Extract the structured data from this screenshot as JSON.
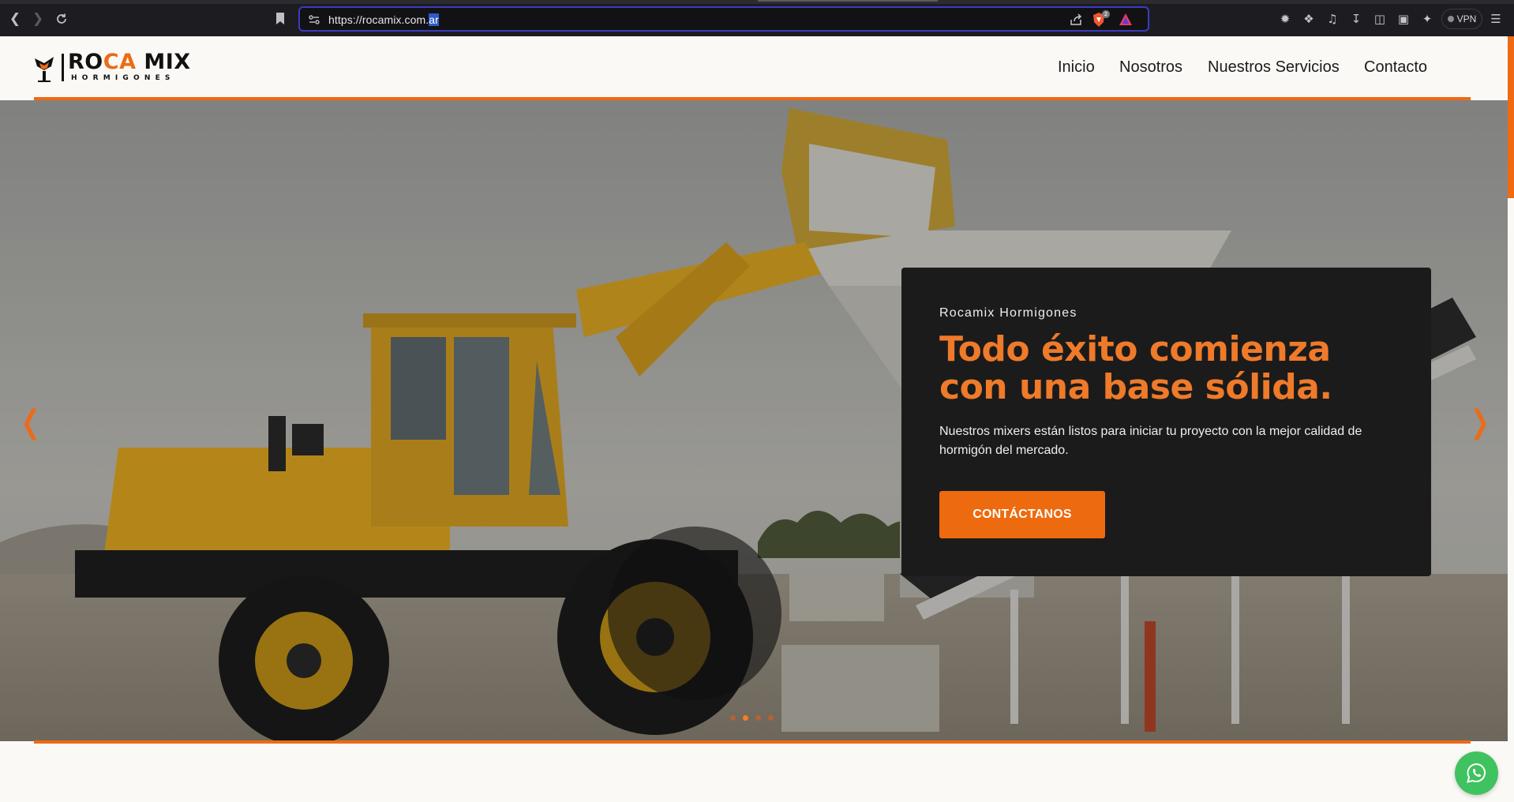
{
  "browser": {
    "url_prefix": "https://rocamix.com.",
    "url_selected": "ar",
    "shield_count": "2",
    "vpn_label": "VPN"
  },
  "site": {
    "logo": {
      "word_part1": "RO",
      "word_accent": "CA",
      "word_part2": " MIX",
      "subtitle": "HORMIGONES"
    },
    "nav": [
      "Inicio",
      "Nosotros",
      "Nuestros Servicios",
      "Contacto"
    ]
  },
  "hero": {
    "kicker": "Rocamix Hormigones",
    "title": "Todo éxito comienza con una base sólida.",
    "text": "Nuestros mixers están listos para iniciar tu proyecto con la mejor calidad de hormigón del mercado.",
    "cta": "CONTÁCTANOS",
    "prev_arrow": "❬",
    "next_arrow": "❭",
    "slides_total": 4,
    "slide_active": 2
  },
  "colors": {
    "accent": "#ee6a15",
    "caption_bg": "#1b1b1b",
    "whatsapp": "#3fc25f"
  },
  "icons": [
    "back-icon",
    "forward-icon",
    "reload-icon",
    "bookmark-icon",
    "site-settings-icon",
    "share-icon",
    "brave-shield-icon",
    "brave-rewards-icon",
    "extension-icons",
    "menu-icon",
    "whatsapp-icon"
  ]
}
